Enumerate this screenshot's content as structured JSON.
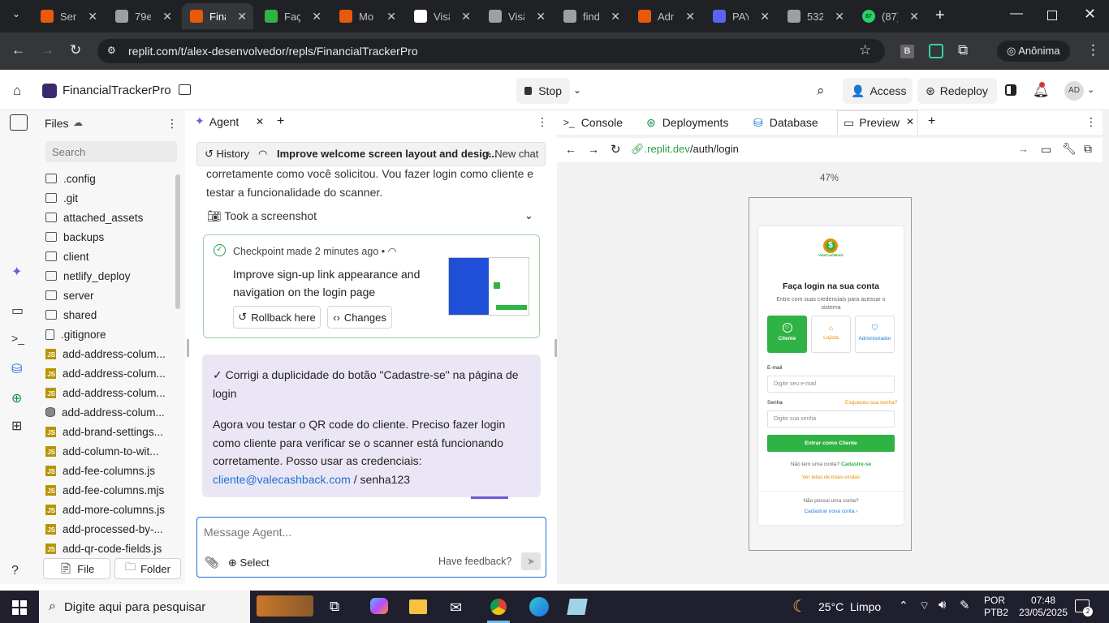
{
  "browser": {
    "tabs": [
      {
        "label": "Sen",
        "color": "#e8590c"
      },
      {
        "label": "79e",
        "color": "#9aa0a6"
      },
      {
        "label": "Fina",
        "color": "#e8590c"
      },
      {
        "label": "Faça",
        "color": "#2fb344"
      },
      {
        "label": "Mo",
        "color": "#e8590c"
      },
      {
        "label": "Visã",
        "color": "#ffffff"
      },
      {
        "label": "Visã",
        "color": "#9aa0a6"
      },
      {
        "label": "find",
        "color": "#9aa0a6"
      },
      {
        "label": "Adn",
        "color": "#e8590c"
      },
      {
        "label": "PAY",
        "color": "#5865f2"
      },
      {
        "label": "532",
        "color": "#9aa0a6"
      },
      {
        "label": "(87)",
        "color": "#25d366"
      }
    ],
    "whatsapp_badge": "87",
    "url": "replit.com/t/alex-desenvolvedor/repls/FinancialTrackerPro",
    "profile_label": "Anônima",
    "ext_b": "B"
  },
  "header": {
    "project_name": "FinancialTrackerPro",
    "stop_label": "Stop",
    "access_label": "Access",
    "redeploy_label": "Redeploy",
    "avatar": "AD"
  },
  "files": {
    "title": "Files",
    "search_placeholder": "Search",
    "items": [
      {
        "name": ".config",
        "type": "folder"
      },
      {
        "name": ".git",
        "type": "folder"
      },
      {
        "name": "attached_assets",
        "type": "folder"
      },
      {
        "name": "backups",
        "type": "folder"
      },
      {
        "name": "client",
        "type": "folder"
      },
      {
        "name": "netlify_deploy",
        "type": "folder"
      },
      {
        "name": "server",
        "type": "folder"
      },
      {
        "name": "shared",
        "type": "folder"
      },
      {
        "name": ".gitignore",
        "type": "file"
      },
      {
        "name": "add-address-colum...",
        "type": "js"
      },
      {
        "name": "add-address-colum...",
        "type": "js"
      },
      {
        "name": "add-address-colum...",
        "type": "js"
      },
      {
        "name": "add-address-colum...",
        "type": "db"
      },
      {
        "name": "add-brand-settings...",
        "type": "js"
      },
      {
        "name": "add-column-to-wit...",
        "type": "js"
      },
      {
        "name": "add-fee-columns.js",
        "type": "js"
      },
      {
        "name": "add-fee-columns.mjs",
        "type": "js"
      },
      {
        "name": "add-more-columns.js",
        "type": "js"
      },
      {
        "name": "add-processed-by-...",
        "type": "js"
      },
      {
        "name": "add-qr-code-fields.js",
        "type": "js"
      }
    ],
    "file_btn": "File",
    "folder_btn": "Folder"
  },
  "agent": {
    "tab_label": "Agent",
    "history_label": "History",
    "chat_title": "Improve welcome screen layout and desig...",
    "new_chat": "+ New chat",
    "msg_top_1": "corretamente como você solicitou. Vou fazer login como cliente e",
    "msg_top_2": "testar a funcionalidade do scanner.",
    "screenshot_label": "Took a screenshot",
    "checkpoint_prefix": "Checkpoint made",
    "checkpoint_time": "2 minutes ago",
    "checkpoint_bullet": "•",
    "checkpoint_title_1": "Improve sign-up link appearance and",
    "checkpoint_title_2": "navigation on the login page",
    "rollback_label": "Rollback here",
    "changes_label": "Changes",
    "msg2_line1": "✓ Corrigi a duplicidade do botão \"Cadastre-se\" na página de",
    "msg2_line2": "login",
    "msg3_line1": "Agora vou testar o QR code do cliente. Preciso fazer login",
    "msg3_line2": "como cliente para verificar se o scanner está funcionando",
    "msg3_line3": "corretamente. Posso usar as credenciais:",
    "msg3_email": "cliente@valecashback.com",
    "msg3_pw": " / senha123",
    "input_placeholder": "Message Agent...",
    "select_label": "Select",
    "feedback_label": "Have feedback?"
  },
  "right": {
    "tabs": [
      "Console",
      "Deployments",
      "Database",
      "Preview"
    ],
    "preview_url_prefix": ".replit.dev",
    "preview_url_path": "/auth/login",
    "zoom": "47%"
  },
  "login": {
    "brand": "ValeCashBack",
    "title": "Faça login na sua conta",
    "subtitle_1": "Entre com suas credenciais para acessar o",
    "subtitle_2": "sistema",
    "roles": [
      "Cliente",
      "Lojista",
      "Administrador"
    ],
    "email_label": "E-mail",
    "email_placeholder": "Digite seu e-mail",
    "pw_label": "Senha",
    "forgot": "Esqueceu sua senha?",
    "pw_placeholder": "Digite sua senha",
    "submit": "Entrar como Cliente",
    "no_account": "Não tem uma conta?",
    "signup": "Cadastre-se",
    "welcome": "Ver telas de boas-vindas",
    "no_account_2": "Não possui uma conta?",
    "register": "Cadastrar nova conta  ›",
    "green": "#2fb344",
    "orange": "#f08c00",
    "blue": "#1c7ed6"
  },
  "taskbar": {
    "search_placeholder": "Digite aqui para pesquisar",
    "weather": "25°C  Limpo",
    "lang_1": "POR",
    "lang_2": "PTB2",
    "time": "07:48",
    "date": "23/05/2025",
    "notif_count": "2"
  }
}
